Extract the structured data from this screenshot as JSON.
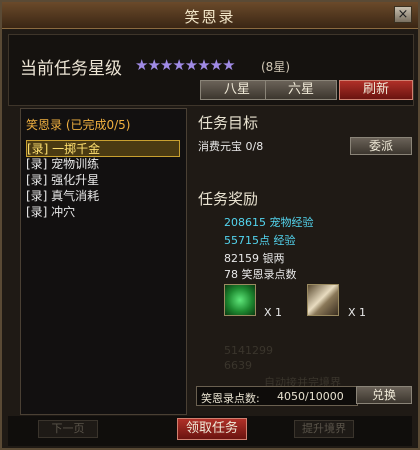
{
  "window": {
    "title": "笑恩录",
    "close_label": "×"
  },
  "header": {
    "star_label": "当前任务星级",
    "stars": "★★★★★★★★",
    "star_count": "(8星)"
  },
  "buttons": {
    "eight_star": "八星",
    "six_star": "六星",
    "refresh": "刷新",
    "assign": "委派",
    "exchange": "兑换",
    "claim": "领取任务",
    "prev_page": "下一页",
    "improve": "提升境界"
  },
  "list": {
    "title": "笑恩录 (已完成0/5)",
    "items": [
      "[录] 一掷千金",
      "[录] 宠物训练",
      "[录] 强化升星",
      "[录] 真气消耗",
      "[录] 冲穴"
    ]
  },
  "goal": {
    "heading": "任务目标",
    "text": "消费元宝 0/8"
  },
  "reward": {
    "heading": "任务奖励",
    "lines": [
      "208615 宠物经验",
      "55715点 经验",
      "82159 银两",
      "78 笑恩录点数"
    ],
    "qty1": "X 1",
    "qty2": "X 1"
  },
  "points": {
    "label": "笑恩录点数:",
    "value": "4050/10000"
  },
  "background": {
    "v1": "5141299",
    "v2": "6639",
    "auto": "自动接并完境界"
  },
  "colors": {
    "cyan": "#53d4ee",
    "white": "#e8e8e8",
    "gold": "#f0b040",
    "star": "#a08be6"
  }
}
